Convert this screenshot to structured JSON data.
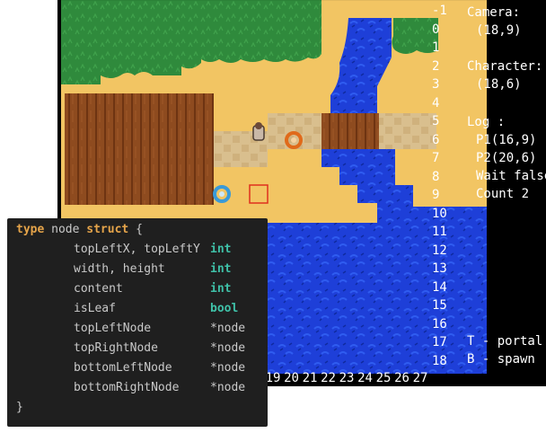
{
  "row_labels": [
    "-1",
    "0",
    "1",
    "2",
    "3",
    "4",
    "5",
    "6",
    "7",
    "8",
    "9",
    "10",
    "11",
    "12",
    "13",
    "14",
    "15",
    "16",
    "17",
    "18"
  ],
  "col_labels": [
    "19",
    "20",
    "21",
    "22",
    "23",
    "24",
    "25",
    "26",
    "27"
  ],
  "side": {
    "camera_label": "Camera:",
    "camera_value": "(18,9)",
    "character_label": "Character:",
    "character_value": "(18,6)",
    "log_label": "Log :",
    "p1": "P1(16,9)",
    "p2": "P2(20,6)",
    "wait": "Wait false",
    "count": "Count 2",
    "legend_t": "T - portal",
    "legend_b": "B - spawn"
  },
  "code": {
    "kw_type": "type",
    "name": "node",
    "kw_struct": "struct",
    "open": "{",
    "close": "}",
    "fields": [
      {
        "name": "topLeftX, topLeftY",
        "type": "int"
      },
      {
        "name": "width, height",
        "type": "int"
      },
      {
        "name": "content",
        "type": "int"
      },
      {
        "name": "isLeaf",
        "type": "bool"
      },
      {
        "name": "topLeftNode",
        "type": "*node"
      },
      {
        "name": "topRightNode",
        "type": "*node"
      },
      {
        "name": "bottomLeftNode",
        "type": "*node"
      },
      {
        "name": "bottomRightNode",
        "type": "*node"
      }
    ]
  },
  "colors": {
    "grass": "#2e8a3e",
    "sand": "#f2c463",
    "dirt": "#8b4a1e",
    "water": "#1a3fd4",
    "path": "#d8b98a",
    "cursor": "#e0301e",
    "portal_orange": "#e06a1a",
    "portal_blue": "#3a9ad8"
  }
}
